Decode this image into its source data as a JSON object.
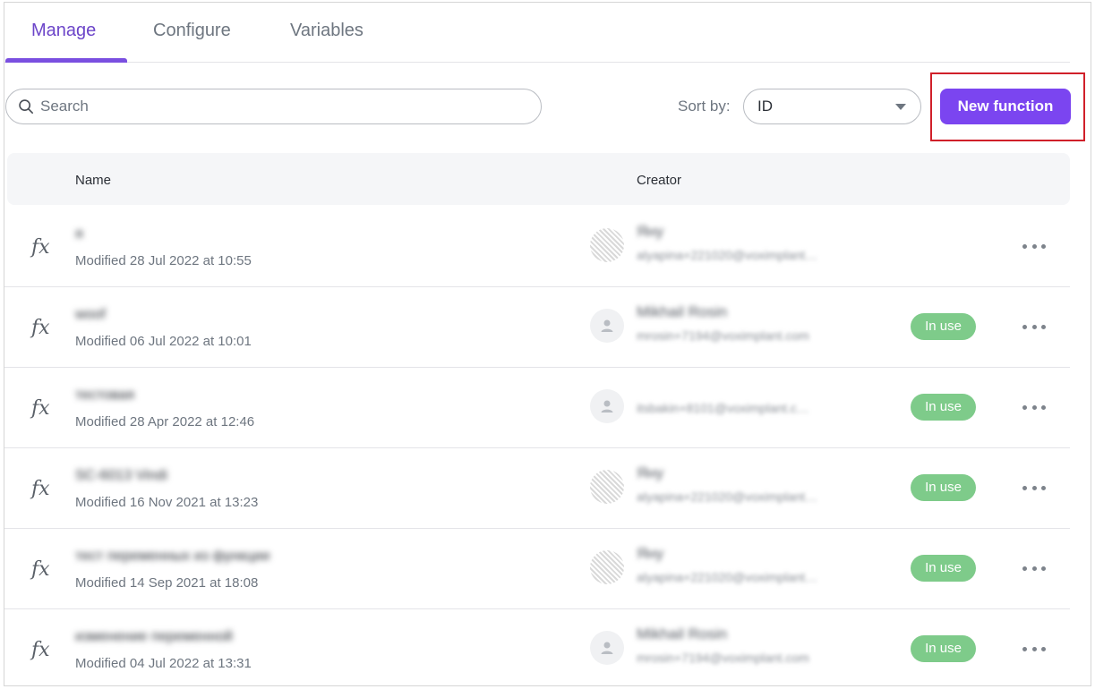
{
  "tabs": [
    {
      "label": "Manage",
      "active": true
    },
    {
      "label": "Configure",
      "active": false
    },
    {
      "label": "Variables",
      "active": false
    }
  ],
  "toolbar": {
    "search_placeholder": "Search",
    "sort_label": "Sort by:",
    "sort_value": "ID",
    "new_function_label": "New function"
  },
  "table": {
    "columns": [
      "Name",
      "Creator"
    ],
    "rows": [
      {
        "name": "я",
        "modified": "Modified 28 Jul 2022 at 10:55",
        "creator_name": "Яну",
        "creator_email": "alyapina+221020@voximplant…",
        "avatar": "pattern",
        "badge": ""
      },
      {
        "name": "woof",
        "modified": "Modified 06 Jul 2022 at 10:01",
        "creator_name": "Mikhail Rosin",
        "creator_email": "mrosin+7194@voximplant.com",
        "avatar": "person",
        "badge": "In use"
      },
      {
        "name": "тестовая",
        "modified": "Modified 28 Apr 2022 at 12:46",
        "creator_name": "",
        "creator_email": "itsbakin+8101@voximplant.c…",
        "avatar": "person",
        "badge": "In use"
      },
      {
        "name": "SC-6013 Vindi",
        "modified": "Modified 16 Nov 2021 at 13:23",
        "creator_name": "Яну",
        "creator_email": "alyapina+221020@voximplant…",
        "avatar": "pattern",
        "badge": "In use"
      },
      {
        "name": "тест переменных из функции",
        "modified": "Modified 14 Sep 2021 at 18:08",
        "creator_name": "Яну",
        "creator_email": "alyapina+221020@voximplant…",
        "avatar": "pattern",
        "badge": "In use"
      },
      {
        "name": "изменение переменной",
        "modified": "Modified 04 Jul 2022 at 13:31",
        "creator_name": "Mikhail Rosin",
        "creator_email": "mrosin+7194@voximplant.com",
        "avatar": "person",
        "badge": "In use"
      }
    ]
  },
  "colors": {
    "accent": "#7b45f0",
    "tab_active": "#6c45c9",
    "badge_green": "#7ecb8a",
    "highlight_red": "#d0202a"
  },
  "icons": [
    "search-icon",
    "chevron-down-icon",
    "function-icon",
    "user-icon",
    "more-icon"
  ]
}
